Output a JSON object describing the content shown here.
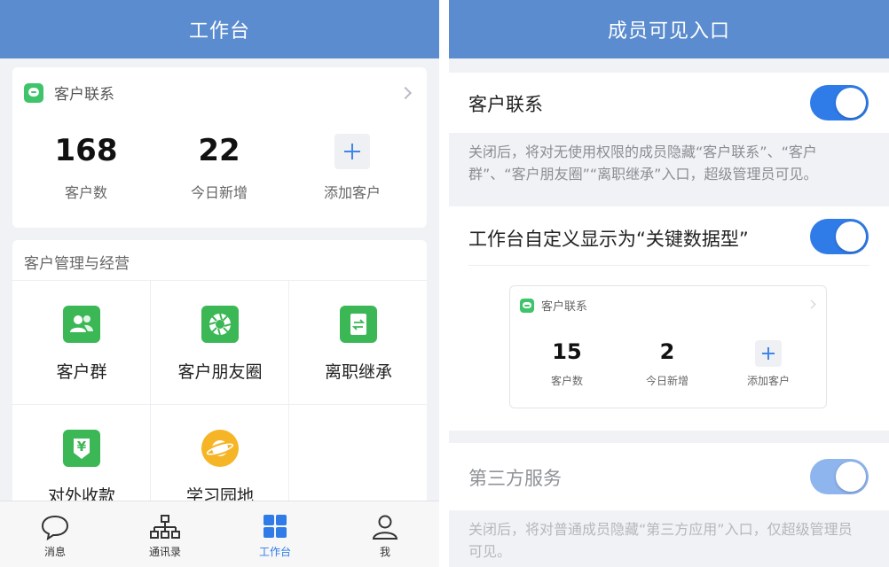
{
  "left": {
    "title": "工作台",
    "customer_card": {
      "title": "客户联系",
      "stats": [
        {
          "value": "168",
          "label": "客户数"
        },
        {
          "value": "22",
          "label": "今日新增"
        }
      ],
      "add_label": "添加客户"
    },
    "management": {
      "title": "客户管理与经营",
      "tools": [
        {
          "name": "客户群",
          "icon": "customer-group-icon"
        },
        {
          "name": "客户朋友圈",
          "icon": "moments-shutter-icon"
        },
        {
          "name": "离职继承",
          "icon": "transfer-doc-icon"
        },
        {
          "name": "对外收款",
          "icon": "yuan-payment-icon"
        },
        {
          "name": "学习园地",
          "icon": "planet-icon"
        }
      ],
      "payment_glyph": "¥",
      "transfer_glyph": "⇆"
    },
    "tabbar": [
      {
        "label": "消息",
        "icon": "chat-bubble-icon",
        "active": false
      },
      {
        "label": "通讯录",
        "icon": "org-chart-icon",
        "active": false
      },
      {
        "label": "工作台",
        "icon": "grid-icon",
        "active": true
      },
      {
        "label": "我",
        "icon": "person-icon",
        "active": false
      }
    ]
  },
  "right": {
    "title": "成员可见入口",
    "rows": [
      {
        "title": "客户联系",
        "enabled": true,
        "note": "关闭后，将对无使用权限的成员隐藏“客户联系”、“客户群”、“客户朋友圈”“离职继承”入口，超级管理员可见。"
      },
      {
        "title": "工作台自定义显示为“关键数据型”",
        "enabled": true
      },
      {
        "title": "第三方服务",
        "enabled": true,
        "note": "关闭后，将对普通成员隐藏“第三方应用”入口，仅超级管理员可见。"
      }
    ],
    "preview": {
      "title": "客户联系",
      "stats": [
        {
          "value": "15",
          "label": "客户数"
        },
        {
          "value": "2",
          "label": "今日新增"
        }
      ],
      "add_label": "添加客户"
    }
  },
  "colors": {
    "nav": "#5b8ccf",
    "accent": "#2f7be8",
    "green": "#3bb755",
    "yellow": "#f5b526"
  }
}
